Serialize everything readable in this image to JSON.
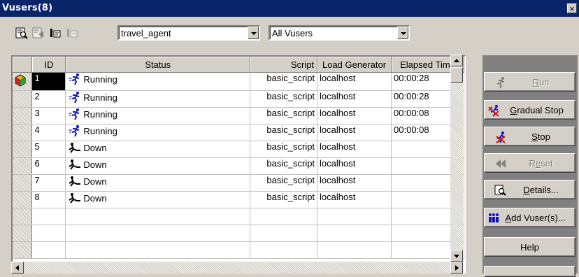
{
  "window": {
    "title": "Vusers(8)",
    "close_glyph": "×"
  },
  "toolbar": {
    "icons": [
      "details-icon",
      "run-until-completion-icon",
      "play-icon",
      "stop-icon"
    ],
    "script_select": {
      "value": "travel_agent"
    },
    "filter_select": {
      "value": "All Vusers"
    }
  },
  "grid": {
    "columns": [
      "ID",
      "Status",
      "Script",
      "Load Generator",
      "Elapsed Time"
    ],
    "rows": [
      {
        "id": "1",
        "status": "Running",
        "status_icon": "running-icon",
        "script": "basic_script",
        "generator": "localhost",
        "elapsed": "00:00:28"
      },
      {
        "id": "2",
        "status": "Running",
        "status_icon": "running-icon",
        "script": "basic_script",
        "generator": "localhost",
        "elapsed": "00:00:28"
      },
      {
        "id": "3",
        "status": "Running",
        "status_icon": "running-icon",
        "script": "basic_script",
        "generator": "localhost",
        "elapsed": "00:00:08"
      },
      {
        "id": "4",
        "status": "Running",
        "status_icon": "running-icon",
        "script": "basic_script",
        "generator": "localhost",
        "elapsed": "00:00:08"
      },
      {
        "id": "5",
        "status": "Down",
        "status_icon": "down-icon",
        "script": "basic_script",
        "generator": "localhost",
        "elapsed": ""
      },
      {
        "id": "6",
        "status": "Down",
        "status_icon": "down-icon",
        "script": "basic_script",
        "generator": "localhost",
        "elapsed": ""
      },
      {
        "id": "7",
        "status": "Down",
        "status_icon": "down-icon",
        "script": "basic_script",
        "generator": "localhost",
        "elapsed": ""
      },
      {
        "id": "8",
        "status": "Down",
        "status_icon": "down-icon",
        "script": "basic_script",
        "generator": "localhost",
        "elapsed": ""
      }
    ]
  },
  "buttons": {
    "run": "Run",
    "gradual_stop": "Gradual Stop",
    "stop": "Stop",
    "reset": "Reset",
    "details": "Details...",
    "add_vusers": "Add Vuser(s)...",
    "help": "Help"
  },
  "colors": {
    "title_bar": "#0a246a",
    "face": "#d4d0c8",
    "running_icon": "#1010c0",
    "stop_red": "#d01010"
  }
}
